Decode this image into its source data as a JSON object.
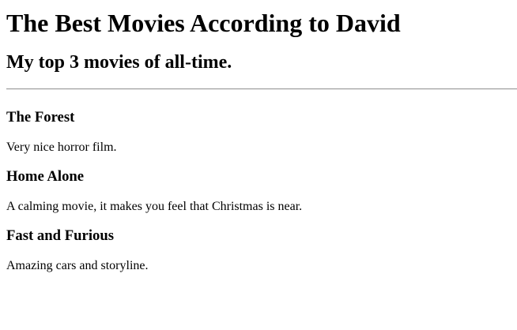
{
  "header": {
    "title": "The Best Movies According to David",
    "subtitle": "My top 3 movies of all-time."
  },
  "movies": [
    {
      "title": "The Forest",
      "description": "Very nice horror film."
    },
    {
      "title": "Home Alone",
      "description": "A calming movie, it makes you feel that Christmas is near."
    },
    {
      "title": "Fast and Furious",
      "description": "Amazing cars and storyline."
    }
  ]
}
